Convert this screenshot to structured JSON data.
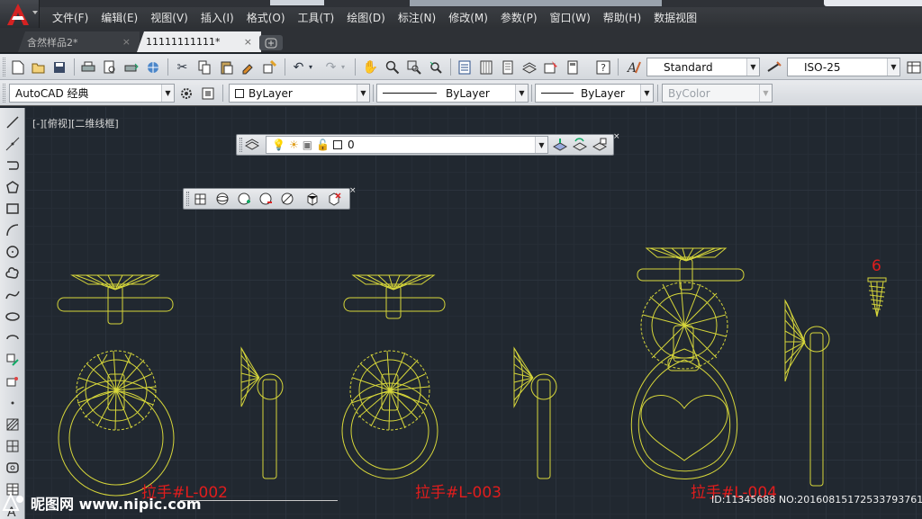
{
  "menu": [
    "文件(F)",
    "编辑(E)",
    "视图(V)",
    "插入(I)",
    "格式(O)",
    "工具(T)",
    "绘图(D)",
    "标注(N)",
    "修改(M)",
    "参数(P)",
    "窗口(W)",
    "帮助(H)",
    "数据视图"
  ],
  "tabs": [
    {
      "label": "含然样品2*",
      "close": "×"
    },
    {
      "label": "11111111111*",
      "close": "×"
    }
  ],
  "toolbar": {
    "text_style": "Standard",
    "dim_style": "ISO-25",
    "workspace": "AutoCAD 经典",
    "color": "ByLayer",
    "linetype": "ByLayer",
    "lineweight": "ByLayer",
    "plot_style": "ByColor"
  },
  "viewport_label": "[-][俯视][二维线框]",
  "layer": {
    "name": "0"
  },
  "labels": {
    "l002": "拉手#L-002",
    "l003": "拉手#L-003",
    "l004": "拉手#L-004",
    "screw": "6"
  },
  "watermark": {
    "left": "昵图网 www.nipic.com",
    "right": "ID:11345688 NO:20160815172533793761"
  },
  "colors": {
    "drawing_line": "#d6d63a",
    "label": "#e11d1d",
    "canvas": "#212830"
  },
  "icons": [
    "autocad-logo-icon",
    "new-icon",
    "open-icon",
    "save-icon",
    "print-icon",
    "preview-icon",
    "publish-icon",
    "cut-icon",
    "copy-icon",
    "paste-icon",
    "match-properties-icon",
    "undo-icon",
    "redo-icon",
    "pan-icon",
    "zoom-icon",
    "properties-icon",
    "help-icon",
    "layer-icon",
    "lightbulb-icon",
    "sun-icon",
    "close-icon"
  ]
}
